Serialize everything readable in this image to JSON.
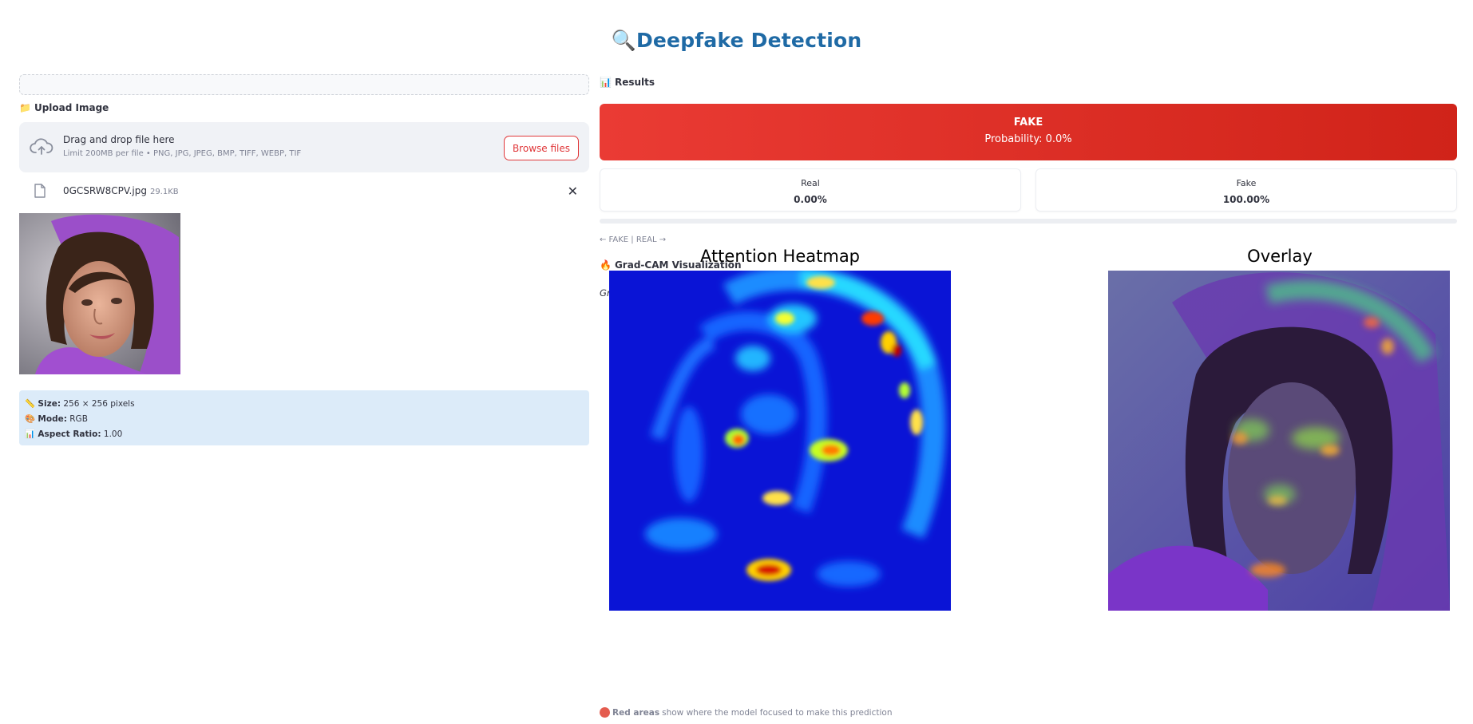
{
  "header": {
    "title_icon": "magnifier-icon",
    "title": "Deepfake Detection"
  },
  "upload": {
    "section_label": "Upload Image",
    "dropzone_title": "Drag and drop file here",
    "dropzone_subtitle": "Limit 200MB per file • PNG, JPG, JPEG, BMP, TIFF, WEBP, TIF",
    "browse_label": "Browse files",
    "file_name": "0GCSRW8CPV.jpg",
    "file_size": "29.1KB"
  },
  "image_info": {
    "size_label": "Size:",
    "size_value": "256 × 256 pixels",
    "mode_label": "Mode:",
    "mode_value": "RGB",
    "aspect_label": "Aspect Ratio:",
    "aspect_value": "1.00"
  },
  "results": {
    "section_label": "Results",
    "verdict": "FAKE",
    "probability_text": "Probability: 0.0%",
    "verdict_color": "#d9291f",
    "metrics": [
      {
        "label": "Real",
        "value": "0.00%"
      },
      {
        "label": "Fake",
        "value": "100.00%"
      }
    ],
    "real_probability": 0.0,
    "axis_caption": "← FAKE | REAL →"
  },
  "gradcam": {
    "section_label": "Grad-CAM Visualization",
    "subtitle": "Gradient-weighted Class Activation Mapping",
    "plots": [
      {
        "title": "Attention Heatmap"
      },
      {
        "title": "Overlay"
      }
    ],
    "footnote_bold": "Red areas",
    "footnote_rest": "show where the model focused to make this prediction"
  }
}
